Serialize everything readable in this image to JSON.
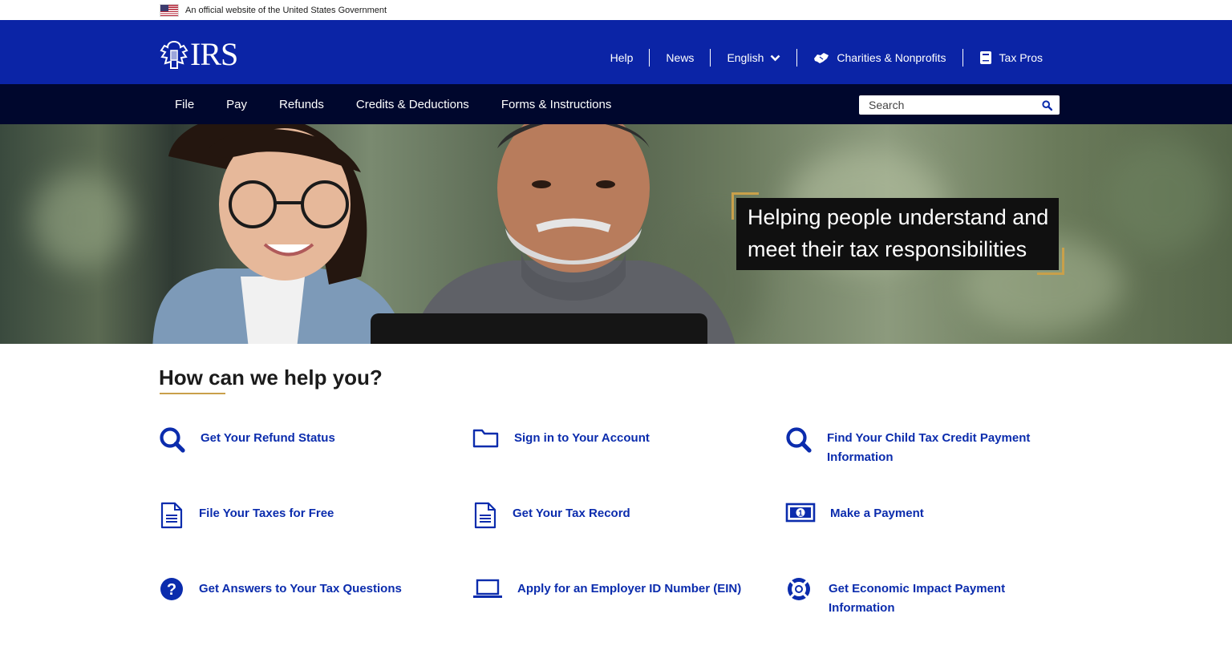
{
  "gov_banner": {
    "text": "An official website of the United States Government"
  },
  "header": {
    "logo_text": "IRS",
    "util_nav": [
      {
        "label": "Help"
      },
      {
        "label": "News"
      },
      {
        "label": "English"
      },
      {
        "label": "Charities & Nonprofits"
      },
      {
        "label": "Tax Pros"
      }
    ]
  },
  "main_nav": {
    "items": [
      {
        "label": "File"
      },
      {
        "label": "Pay"
      },
      {
        "label": "Refunds"
      },
      {
        "label": "Credits & Deductions"
      },
      {
        "label": "Forms & Instructions"
      }
    ],
    "search_placeholder": "Search"
  },
  "hero": {
    "caption_line1": "Helping people understand and",
    "caption_line2": "meet their tax responsibilities"
  },
  "help": {
    "title": "How can we help you?",
    "tasks": [
      {
        "label": "Get Your Refund Status",
        "icon": "search-icon"
      },
      {
        "label": "Sign in to Your Account",
        "icon": "folder-icon"
      },
      {
        "label": "Find Your Child Tax Credit Payment Information",
        "icon": "search-icon"
      },
      {
        "label": "File Your Taxes for Free",
        "icon": "document-icon"
      },
      {
        "label": "Get Your Tax Record",
        "icon": "document-icon"
      },
      {
        "label": "Make a Payment",
        "icon": "money-icon"
      },
      {
        "label": "Get Answers to Your Tax Questions",
        "icon": "question-icon"
      },
      {
        "label": "Apply for an Employer ID Number (EIN)",
        "icon": "laptop-icon"
      },
      {
        "label": "Get Economic Impact Payment Information",
        "icon": "lifebuoy-icon"
      }
    ]
  },
  "colors": {
    "header_blue": "#0b24a6",
    "nav_navy": "#00072d",
    "link_blue": "#0b2cad",
    "accent_gold": "#c9a04a"
  }
}
